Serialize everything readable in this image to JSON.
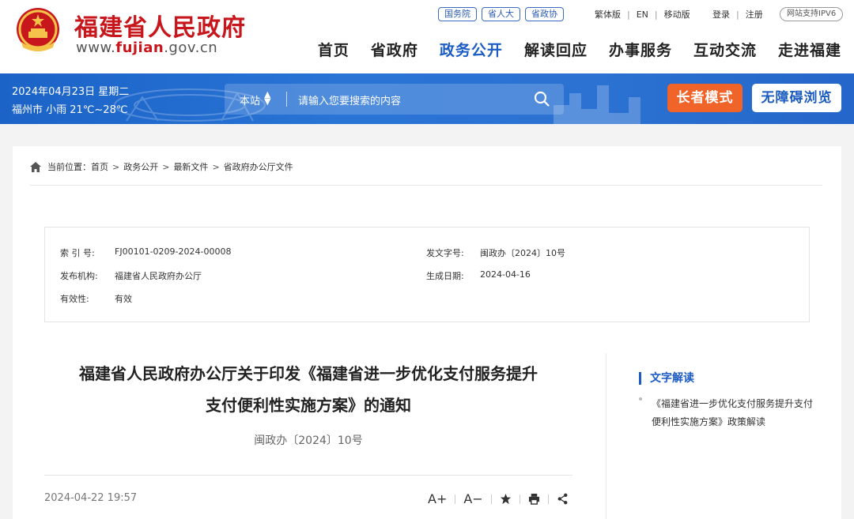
{
  "header": {
    "site_name": "福建省人民政府",
    "url_prefix": "www.",
    "url_domain": "fujian",
    "url_suffix": ".gov.cn",
    "link_buttons": [
      "国务院",
      "省人大",
      "省政协"
    ],
    "util_links": [
      "繁体版",
      "EN",
      "移动版"
    ],
    "login": "登录",
    "register": "注册",
    "ipv6": "网站支持IPV6",
    "nav": [
      "首页",
      "省政府",
      "务公开",
      "解读回应",
      "办事服务",
      "互动交流",
      "走进福建"
    ],
    "nav_active_index": 2
  },
  "band": {
    "date": "2024年04月23日 星期二",
    "weather": "福州市 小雨 21℃~28℃",
    "search_scope": "本站",
    "search_placeholder": "请输入您要搜索的内容",
    "elder_mode": "长者模式",
    "accessible": "无障碍浏览"
  },
  "breadcrumb": {
    "label": "当前位置：",
    "items": [
      "首页",
      "政务公开",
      "最新文件",
      "省政府办公厅文件"
    ]
  },
  "meta": {
    "index_no_label": "索 引 号:",
    "index_no": "FJ00101-0209-2024-00008",
    "doc_no_label": "发文字号:",
    "doc_no": "闽政办〔2024〕10号",
    "issuer_label": "发布机构:",
    "issuer": "福建省人民政府办公厅",
    "date_label": "生成日期:",
    "date": "2024-04-16",
    "validity_label": "有效性:",
    "validity": "有效"
  },
  "article": {
    "title_line1": "福建省人民政府办公厅关于印发《福建省进一步优化支付服务提升",
    "title_line2": "支付便利性实施方案》的通知",
    "doc_no": "闽政办〔2024〕10号",
    "pub_time": "2024-04-22 19:57",
    "font_increase": "A+",
    "font_decrease": "A−"
  },
  "sidebar": {
    "title": "文字解读",
    "link": "《福建省进一步优化支付服务提升支付便利性实施方案》政策解读"
  },
  "colors": {
    "brand_red": "#c8161d",
    "brand_blue": "#1a5bc4",
    "elder_orange": "#f0642a"
  }
}
